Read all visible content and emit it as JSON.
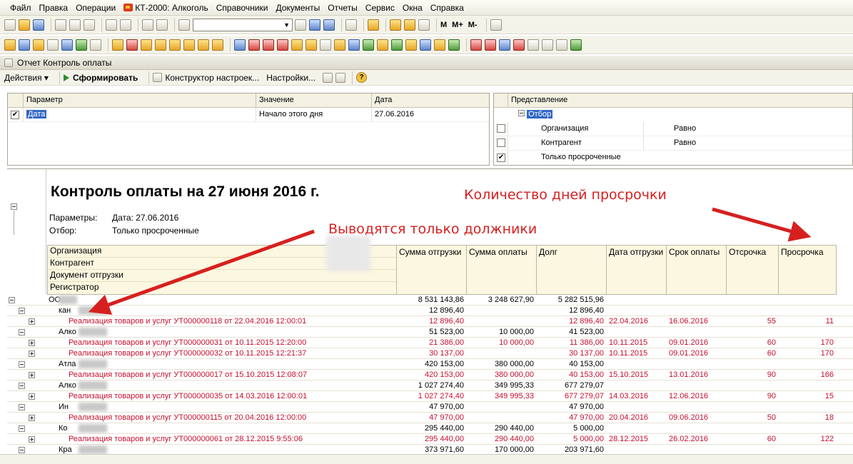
{
  "menu": {
    "file": "Файл",
    "edit": "Правка",
    "operations": "Операции",
    "app": "КТ-2000: Алкоголь",
    "refs": "Справочники",
    "docs": "Документы",
    "reports": "Отчеты",
    "service": "Сервис",
    "windows": "Окна",
    "help": "Справка"
  },
  "toolbar": {
    "m": "M",
    "mplus": "M+",
    "mminus": "M-",
    "combo_value": ""
  },
  "window": {
    "title": "Отчет  Контроль оплаты"
  },
  "actions": {
    "actions": "Действия",
    "generate": "Сформировать",
    "constructor": "Конструктор настроек...",
    "settings": "Настройки..."
  },
  "params": {
    "headers": {
      "param": "Параметр",
      "value": "Значение",
      "date": "Дата"
    },
    "row": {
      "param": "Дата",
      "value": "Начало этого дня",
      "date": "27.06.2016"
    }
  },
  "filter": {
    "header": "Представление",
    "group": "Отбор",
    "items": [
      {
        "label": "Организация",
        "cond": "Равно"
      },
      {
        "label": "Контрагент",
        "cond": "Равно"
      },
      {
        "label": "Только просроченные",
        "cond": ""
      }
    ]
  },
  "report": {
    "title": "Контроль оплаты на 27 июня 2016 г.",
    "params_label": "Параметры:",
    "params_value": "Дата: 27.06.2016",
    "filter_label": "Отбор:",
    "filter_value": "Только просроченные",
    "col_left": [
      "Организация",
      "Контрагент",
      "Документ отгрузки",
      "Регистратор"
    ],
    "cols": {
      "ship_sum": "Сумма отгрузки",
      "pay_sum": "Сумма оплаты",
      "debt": "Долг",
      "ship_date": "Дата отгрузки",
      "pay_term": "Срок оплаты",
      "delay": "Отсрочка",
      "overdue": "Просрочка"
    },
    "rows": [
      {
        "type": "org",
        "label": "ОО",
        "ship": "8 531 143,86",
        "pay": "3 248 627,90",
        "debt": "5 282 515,96",
        "sdate": "",
        "term": "",
        "delay": "",
        "over": ""
      },
      {
        "type": "ctr",
        "label": "кан",
        "ship": "12 896,40",
        "pay": "",
        "debt": "12 896,40",
        "sdate": "",
        "term": "",
        "delay": "",
        "over": ""
      },
      {
        "type": "doc",
        "label": "Реализация товаров и услуг УТ000000118 от 22.04.2016 12:00:01",
        "ship": "12 896,40",
        "pay": "",
        "debt": "12 896,40",
        "sdate": "22.04.2016",
        "term": "16.06.2016",
        "delay": "55",
        "over": "11"
      },
      {
        "type": "ctr",
        "label": "Алко",
        "ship": "51 523,00",
        "pay": "10 000,00",
        "debt": "41 523,00",
        "sdate": "",
        "term": "",
        "delay": "",
        "over": ""
      },
      {
        "type": "doc",
        "label": "Реализация товаров и услуг УТ000000031 от 10.11.2015 12:20:00",
        "ship": "21 386,00",
        "pay": "10 000,00",
        "debt": "11 386,00",
        "sdate": "10.11.2015",
        "term": "09.01.2016",
        "delay": "60",
        "over": "170"
      },
      {
        "type": "doc",
        "label": "Реализация товаров и услуг УТ000000032 от 10.11.2015 12:21:37",
        "ship": "30 137,00",
        "pay": "",
        "debt": "30 137,00",
        "sdate": "10.11.2015",
        "term": "09.01.2016",
        "delay": "60",
        "over": "170"
      },
      {
        "type": "ctr",
        "label": "Атла",
        "ship": "420 153,00",
        "pay": "380 000,00",
        "debt": "40 153,00",
        "sdate": "",
        "term": "",
        "delay": "",
        "over": ""
      },
      {
        "type": "doc",
        "label": "Реализация товаров и услуг УТ000000017 от 15.10.2015 12:08:07",
        "ship": "420 153,00",
        "pay": "380 000,00",
        "debt": "40 153,00",
        "sdate": "15.10.2015",
        "term": "13.01.2016",
        "delay": "90",
        "over": "166"
      },
      {
        "type": "ctr",
        "label": "Алко",
        "ship": "1 027 274,40",
        "pay": "349 995,33",
        "debt": "677 279,07",
        "sdate": "",
        "term": "",
        "delay": "",
        "over": ""
      },
      {
        "type": "doc",
        "label": "Реализация товаров и услуг УТ000000035 от 14.03.2016 12:00:01",
        "ship": "1 027 274,40",
        "pay": "349 995,33",
        "debt": "677 279,07",
        "sdate": "14.03.2016",
        "term": "12.06.2016",
        "delay": "90",
        "over": "15"
      },
      {
        "type": "ctr",
        "label": "Ин",
        "ship": "47 970,00",
        "pay": "",
        "debt": "47 970,00",
        "sdate": "",
        "term": "",
        "delay": "",
        "over": ""
      },
      {
        "type": "doc",
        "label": "Реализация товаров и услуг УТ000000115 от 20.04.2016 12:00:00",
        "ship": "47 970,00",
        "pay": "",
        "debt": "47 970,00",
        "sdate": "20.04.2016",
        "term": "09.06.2016",
        "delay": "50",
        "over": "18"
      },
      {
        "type": "ctr",
        "label": "Ко",
        "ship": "295 440,00",
        "pay": "290 440,00",
        "debt": "5 000,00",
        "sdate": "",
        "term": "",
        "delay": "",
        "over": ""
      },
      {
        "type": "doc",
        "label": "Реализация товаров и услуг УТ000000061 от 28.12.2015 9:55:06",
        "ship": "295 440,00",
        "pay": "290 440,00",
        "debt": "5 000,00",
        "sdate": "28.12.2015",
        "term": "26.02.2016",
        "delay": "60",
        "over": "122"
      },
      {
        "type": "ctr",
        "label": "Кра",
        "ship": "373 971,60",
        "pay": "170 000,00",
        "debt": "203 971,60",
        "sdate": "",
        "term": "",
        "delay": "",
        "over": ""
      }
    ]
  },
  "annotations": {
    "overdue_days": "Количество дней просрочки",
    "only_debtors": "Выводятся только должники"
  },
  "colors": {
    "arrow": "#d62020",
    "doc_text": "#c8102e",
    "header_bg": "#fbf7e0"
  }
}
